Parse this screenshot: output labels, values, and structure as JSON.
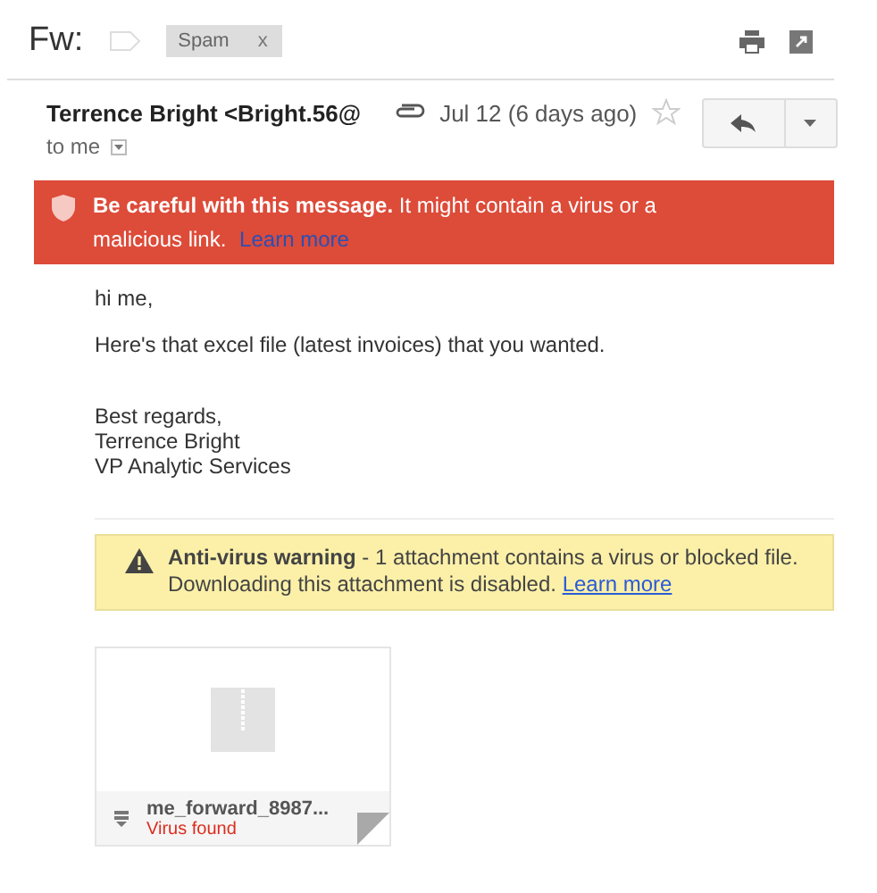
{
  "subject": "Fw:",
  "labels": [
    {
      "text": "Spam",
      "remove": "x"
    }
  ],
  "message": {
    "sender": "Terrence Bright <Bright.56@",
    "recipient": "to me",
    "date": "Jul 12 (6 days ago)",
    "starred": false,
    "has_attachment": true
  },
  "danger_banner": {
    "text": "**Be careful with this message.** It might contain a virus or a malicious link.",
    "link": "Learn more"
  },
  "body": [
    "hi me,",
    "Here's that excel file (latest invoices) that you wanted."
  ],
  "signature": [
    "Best regards,",
    "Terrence Bright",
    "VP Analytic Services"
  ],
  "antivirus_warning": {
    "text": "**Anti-virus warning** - 1 attachment contains a virus or blocked file. Downloading this attachment is disabled.",
    "link": "Learn more"
  },
  "attachments": [
    {
      "name": "me_forward_8987...",
      "status": "Virus found"
    }
  ]
}
